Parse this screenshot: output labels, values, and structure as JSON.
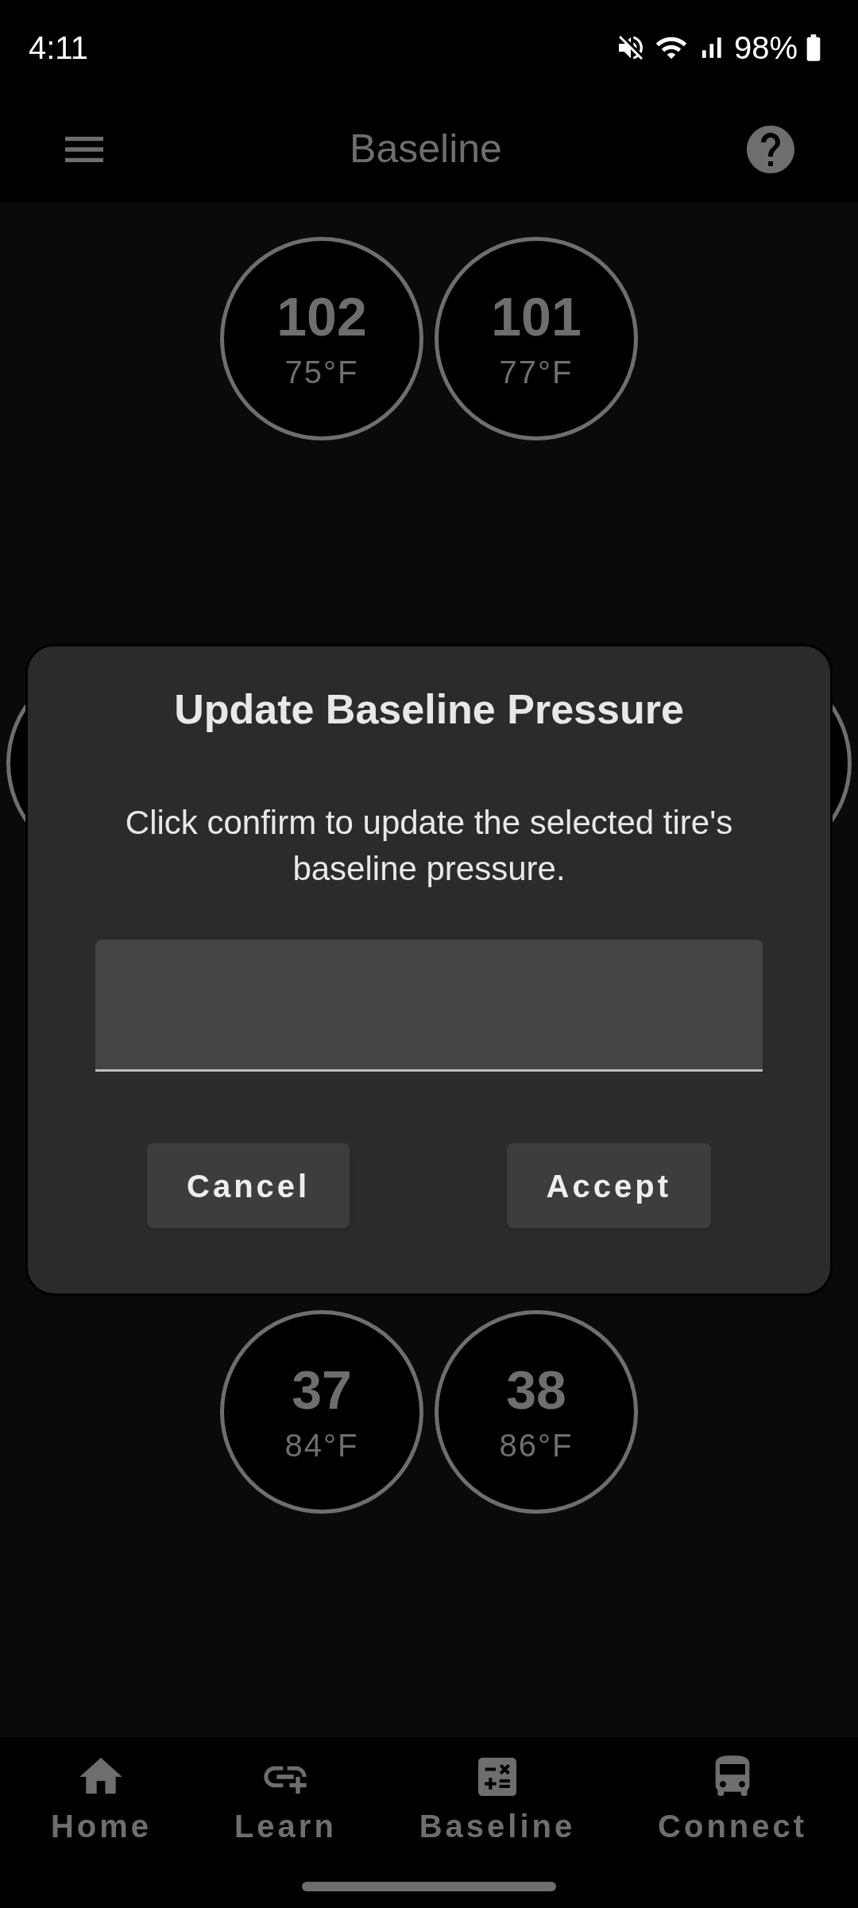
{
  "status_bar": {
    "time": "4:11",
    "battery": "98%"
  },
  "header": {
    "title": "Baseline"
  },
  "tires_top": [
    {
      "pressure": "102",
      "temperature": "75°F"
    },
    {
      "pressure": "101",
      "temperature": "77°F"
    }
  ],
  "tires_bottom": [
    {
      "pressure": "37",
      "temperature": "84°F"
    },
    {
      "pressure": "38",
      "temperature": "86°F"
    }
  ],
  "dialog": {
    "title": "Update Baseline Pressure",
    "message": "Click confirm to update the selected tire's baseline pressure.",
    "buttons": [
      "Cancel",
      "Accept"
    ]
  },
  "bottom_nav": [
    {
      "kind": "home",
      "label": "Home"
    },
    {
      "kind": "learn",
      "label": "Learn"
    },
    {
      "kind": "baseline",
      "label": "Baseline"
    },
    {
      "kind": "connect",
      "label": "Connect"
    }
  ]
}
